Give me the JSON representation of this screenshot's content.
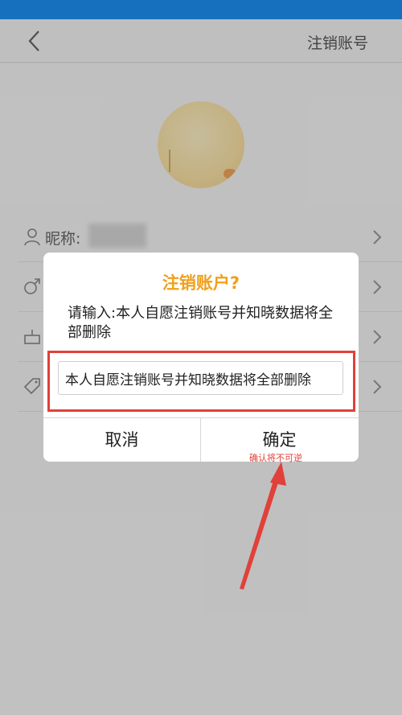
{
  "header": {
    "title": "注销账号"
  },
  "profile": {
    "rows": [
      {
        "label": "昵称:"
      },
      {
        "label": ""
      },
      {
        "label": ""
      },
      {
        "label": ""
      }
    ]
  },
  "dialog": {
    "title": "注销账户?",
    "message": "请输入:本人自愿注销账号并知晓数据将全部删除",
    "input_value": "本人自愿注销账号并知晓数据将全部删除",
    "cancel_label": "取消",
    "confirm_label": "确定"
  },
  "annotation": {
    "text": "确认将不可逆"
  },
  "colors": {
    "status_bar": "#1e90f2",
    "dialog_title": "#f0a01a",
    "annotation_red": "#e0413a"
  }
}
